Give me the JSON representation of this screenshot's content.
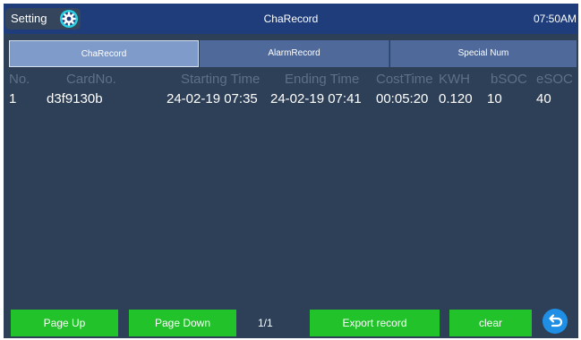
{
  "header": {
    "setting_label": "Setting",
    "title": "ChaRecord",
    "time": "07:50AM"
  },
  "tabs": [
    {
      "label": "ChaRecord",
      "active": true
    },
    {
      "label": "AlarmRecord",
      "active": false
    },
    {
      "label": "Special Num",
      "active": false
    }
  ],
  "table": {
    "columns": [
      "No.",
      "CardNo.",
      "Starting Time",
      "Ending Time",
      "CostTime",
      "KWH",
      "bSOC",
      "eSOC"
    ],
    "rows": [
      [
        "1",
        "d3f9130b",
        "24-02-19 07:35",
        "24-02-19 07:41",
        "00:05:20",
        "0.120",
        "10",
        "40"
      ]
    ]
  },
  "footer": {
    "page_up": "Page Up",
    "page_down": "Page Down",
    "page_indicator": "1/1",
    "export": "Export record",
    "clear": "clear"
  },
  "icons": {
    "settings": "gear-icon",
    "back": "back-arrow-icon"
  },
  "colors": {
    "header_bg": "#1f3d7a",
    "panel_bg": "#2e4057",
    "tab_active": "#7f9bc9",
    "tab_inactive": "#4f6a9a",
    "button_green": "#22c32a",
    "back_button": "#1f8fe6"
  }
}
